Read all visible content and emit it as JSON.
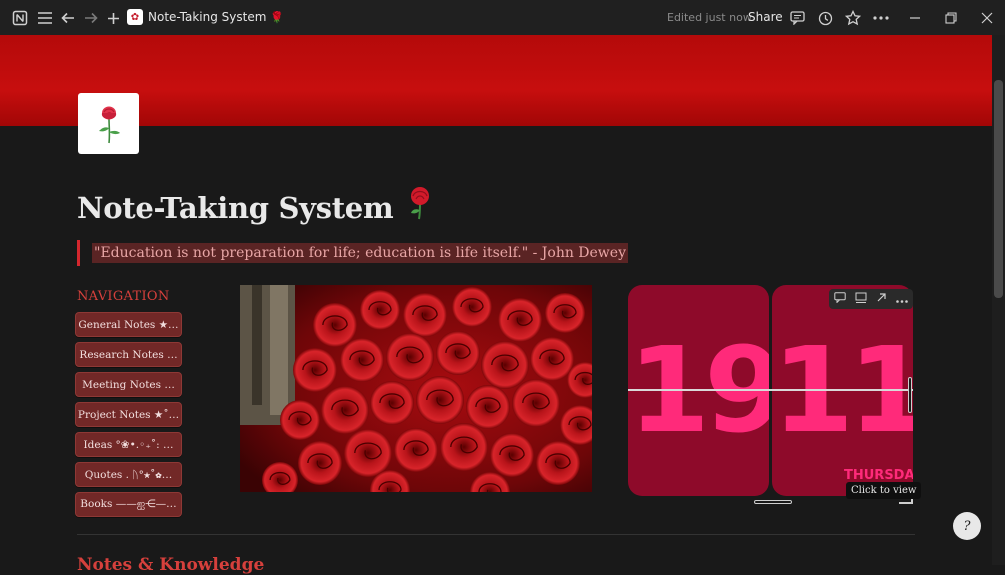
{
  "topbar": {
    "page_title": "Note-Taking System",
    "edited_label": "Edited just now",
    "share_label": "Share"
  },
  "page": {
    "title": "Note-Taking System",
    "quote": "\"Education is not preparation for life; education is life itself.\" - John Dewey",
    "nav_heading": "NAVIGATION",
    "nav_buttons": [
      "General Notes ★…",
      "Research Notes …",
      "Meeting Notes …",
      "Project Notes ★˚…",
      "Ideas °❀•.◦₊˚: …",
      "Quotes . ᚢ°★˚✿…",
      "Books ——ஐ⋲—…"
    ],
    "next_section_heading": "Notes & Knowledge"
  },
  "clock": {
    "hours": "19",
    "minutes": "11",
    "day": "THURSDAY",
    "tooltip": "Click to view"
  },
  "colors": {
    "banner": "#c70e0e",
    "accent": "#d6403c",
    "clock_card": "#8e0a2a",
    "clock_digit": "#ff2a7a"
  },
  "icons": [
    "notion-logo-icon",
    "menu-icon",
    "back-arrow-icon",
    "forward-arrow-icon",
    "plus-icon",
    "comment-icon",
    "history-icon",
    "star-icon",
    "more-icon",
    "minimize-icon",
    "restore-icon",
    "close-icon",
    "rose-icon",
    "help-icon"
  ]
}
